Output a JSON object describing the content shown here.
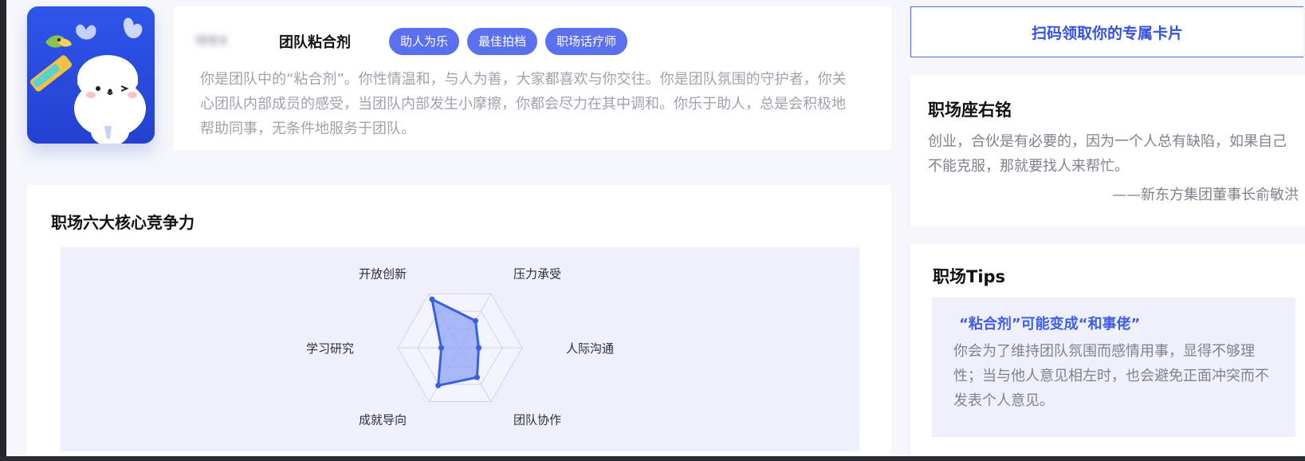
{
  "profile": {
    "name": "噗噗米",
    "title": "团队粘合剂",
    "tags": [
      "助人为乐",
      "最佳拍档",
      "职场话疗师"
    ],
    "description": "你是团队中的“粘合剂”。你性情温和，与人为善，大家都喜欢与你交往。你是团队氛围的守护者，你关心团队内部成员的感受，当团队内部发生小摩擦，你都会尽力在其中调和。你乐于助人，总是会积极地帮助同事，无条件地服务于团队。",
    "avatar_icon": "deer-mascot-icon"
  },
  "competency": {
    "title": "职场六大核心竞争力"
  },
  "chart_data": {
    "type": "radar",
    "axes": [
      "压力承受",
      "人际沟通",
      "团队协作",
      "成就导向",
      "学习研究",
      "开放创新"
    ],
    "values": [
      0.5,
      0.3,
      0.55,
      0.7,
      0.3,
      0.9
    ],
    "range": [
      0,
      1
    ],
    "colors": {
      "fill": "#8fa4f4",
      "stroke": "#3a5fe0",
      "grid": "#cfd3e6"
    }
  },
  "qr": {
    "label": "扫码领取你的专属卡片"
  },
  "quote": {
    "title": "职场座右铭",
    "text": "创业，合伙是有必要的，因为一个人总有缺陷，如果自己不能克服，那就要找人来帮忙。",
    "author": "——新东方集团董事长俞敏洪"
  },
  "tips": {
    "title": "职场Tips",
    "subtitle": "“粘合剂”可能变成“和事佬”",
    "body": "你会为了维持团队氛围而感情用事，显得不够理性；当与他人意见相左时，也会避免正面冲突而不发表个人意见。"
  },
  "colors": {
    "accent": "#3551e4",
    "tag_bg": "#5a70ef",
    "page_bg": "#f4f6fb",
    "panel_bg": "#eef0fb"
  }
}
